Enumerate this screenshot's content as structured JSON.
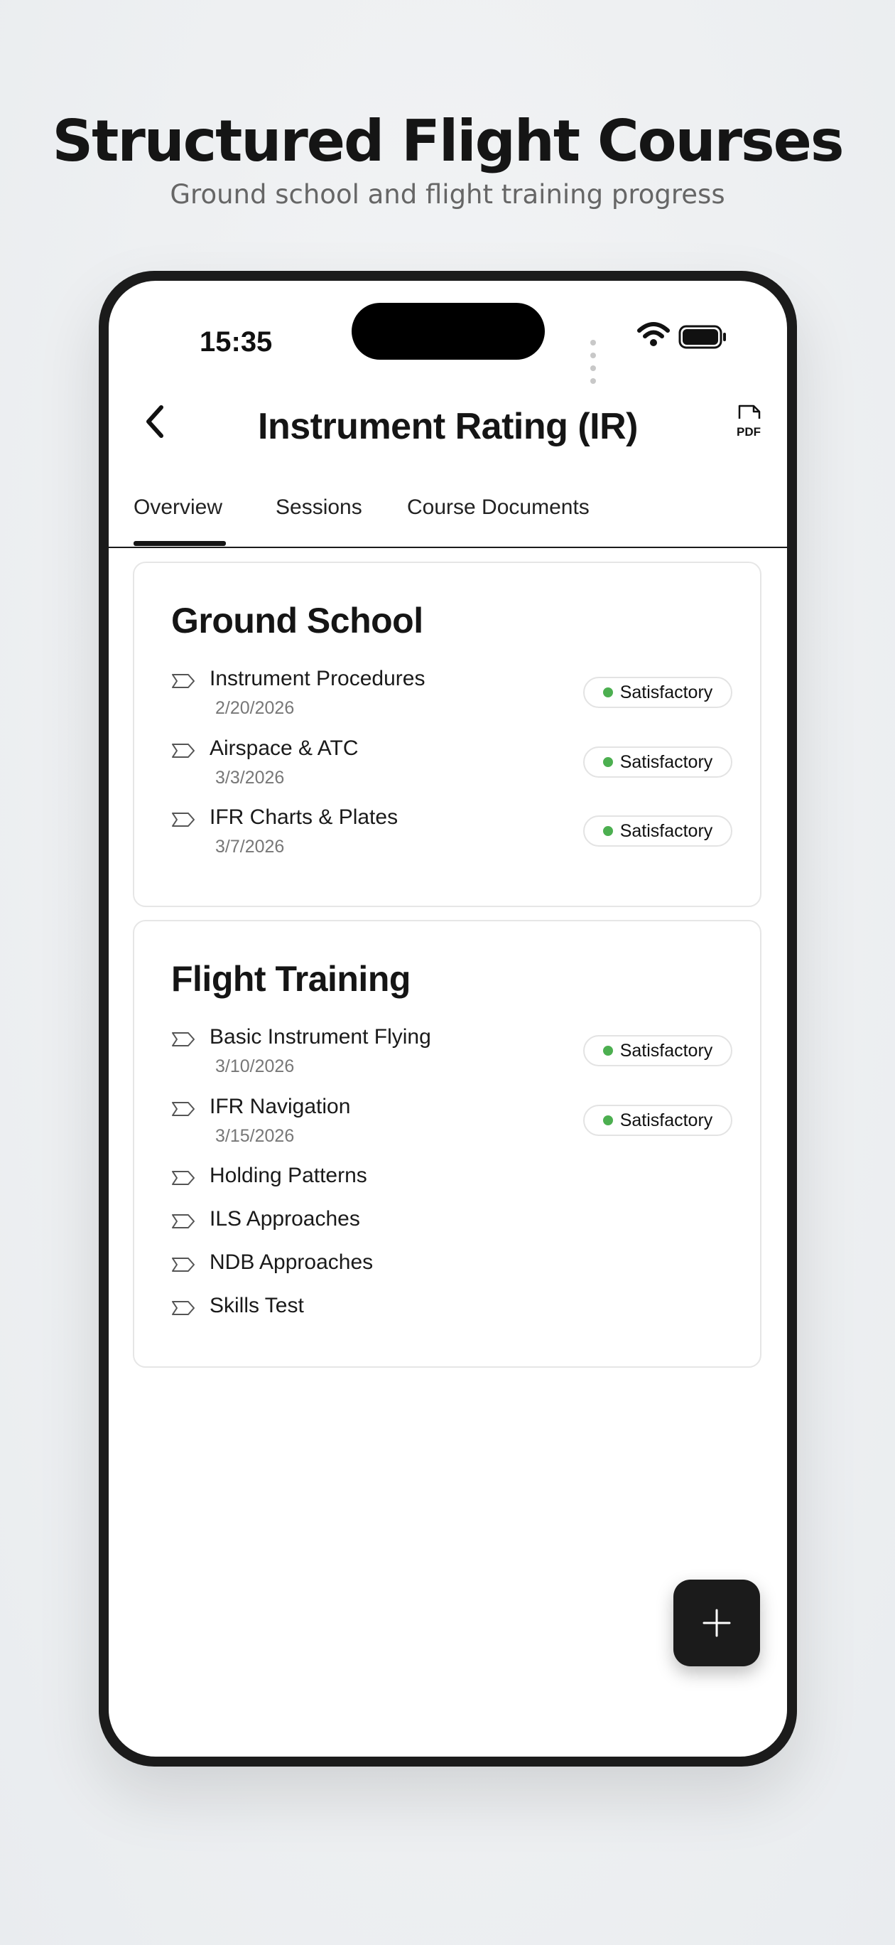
{
  "promo": {
    "title": "Structured Flight Courses",
    "subtitle": "Ground school and flight training progress"
  },
  "status_bar": {
    "time": "15:35"
  },
  "header": {
    "title": "Instrument Rating (IR)",
    "pdf_label": "PDF"
  },
  "tabs": [
    {
      "label": "Overview",
      "active": true
    },
    {
      "label": "Sessions",
      "active": false
    },
    {
      "label": "Course Documents",
      "active": false
    }
  ],
  "ground_school": {
    "title": "Ground School",
    "items": [
      {
        "label": "Instrument Procedures",
        "date": "2/20/2026",
        "status": "Satisfactory"
      },
      {
        "label": "Airspace & ATC",
        "date": "3/3/2026",
        "status": "Satisfactory"
      },
      {
        "label": "IFR Charts & Plates",
        "date": "3/7/2026",
        "status": "Satisfactory"
      }
    ]
  },
  "flight_training": {
    "title": "Flight Training",
    "items": [
      {
        "label": "Basic Instrument Flying",
        "date": "3/10/2026",
        "status": "Satisfactory"
      },
      {
        "label": "IFR Navigation",
        "date": "3/15/2026",
        "status": "Satisfactory"
      },
      {
        "label": "Holding Patterns"
      },
      {
        "label": "ILS Approaches"
      },
      {
        "label": "NDB Approaches"
      },
      {
        "label": "Skills Test"
      }
    ]
  },
  "colors": {
    "status_green": "#4caf50",
    "accent_dark": "#1b1b1b"
  },
  "icons": {
    "back": "chevron-left-icon",
    "pdf": "pdf-file-icon",
    "item": "tag-icon",
    "add": "plus-icon"
  }
}
